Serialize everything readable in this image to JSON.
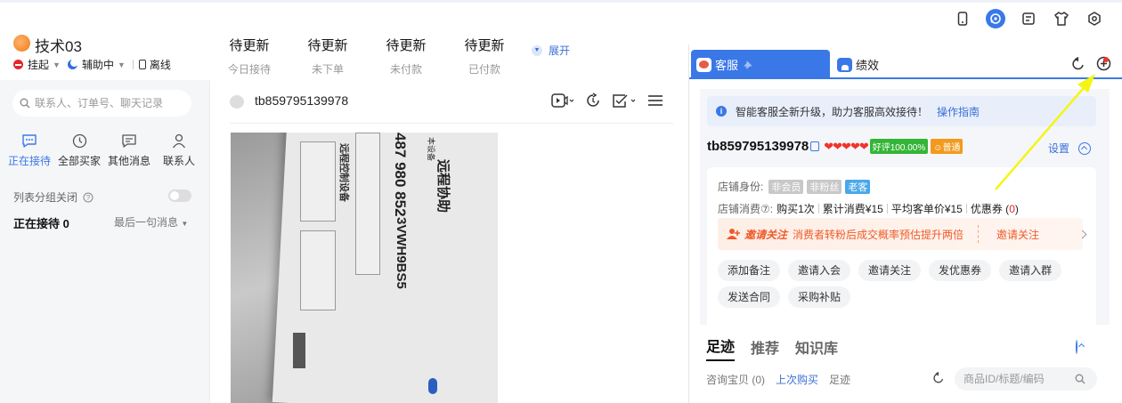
{
  "header": {
    "user_name": "技术03",
    "status_suspend": "挂起",
    "status_assist": "辅助中",
    "status_offline": "离线",
    "stats": [
      {
        "value": "待更新",
        "label": "今日接待"
      },
      {
        "value": "待更新",
        "label": "未下单"
      },
      {
        "value": "待更新",
        "label": "未付款"
      },
      {
        "value": "待更新",
        "label": "已付款"
      }
    ],
    "expand_label": "展开",
    "top_icons": [
      "phone-icon",
      "headset-icon",
      "note-icon",
      "shirt-icon",
      "settings-icon"
    ]
  },
  "left": {
    "search_placeholder": "联系人、订单号、聊天记录",
    "tabs": [
      {
        "label": "正在接待",
        "icon": "chat-icon"
      },
      {
        "label": "全部买家",
        "icon": "clock-icon"
      },
      {
        "label": "其他消息",
        "icon": "message-icon"
      },
      {
        "label": "联系人",
        "icon": "person-icon"
      }
    ],
    "group_label": "列表分组关闭",
    "receiving_label": "正在接待 0",
    "last_msg_label": "最后一句消息"
  },
  "chat": {
    "buyer_name": "tb859795139978",
    "photo_text": {
      "title": "远程协助",
      "code1": "487 980 852",
      "code2": "3VWH9BS5",
      "label1": "本设备",
      "label2": "远程控制设备"
    }
  },
  "right": {
    "tab_service": "客服",
    "tab_performance": "绩效",
    "notice_text": "智能客服全新升级，助力客服高效接待！",
    "notice_link": "操作指南",
    "customer_name": "tb859795139978",
    "hearts": "❤❤❤❤❤",
    "badge_good": "好评100.00%",
    "badge_normal": "普通",
    "settings_label": "设置",
    "identity_label": "店铺身份:",
    "identity_tags": [
      "非会员",
      "非粉丝",
      "老客"
    ],
    "consume_label": "店铺消费⑦:",
    "consume_items": [
      "购买1次",
      "累计消费¥15",
      "平均客单价¥15"
    ],
    "coupon_label": "优惠券 (",
    "coupon_value": "0",
    "coupon_suffix": ")",
    "promo_title": "邀请关注",
    "promo_desc": "消费者转粉后成交概率预估提升两倍",
    "promo_action": "邀请关注",
    "action_buttons": [
      "添加备注",
      "邀请入会",
      "邀请关注",
      "发优惠券",
      "邀请入群",
      "发送合同",
      "采购补贴"
    ],
    "sub_tabs": [
      "足迹",
      "推荐",
      "知识库"
    ],
    "bottom_items": {
      "consult": "咨询宝贝 (0)",
      "last_buy": "上次购买",
      "footprint": "足迹"
    },
    "bottom_search_placeholder": "商品ID/标题/编码"
  },
  "colors": {
    "accent": "#3a78e8",
    "arrow": "#f5f514",
    "promo": "#f05a28"
  }
}
